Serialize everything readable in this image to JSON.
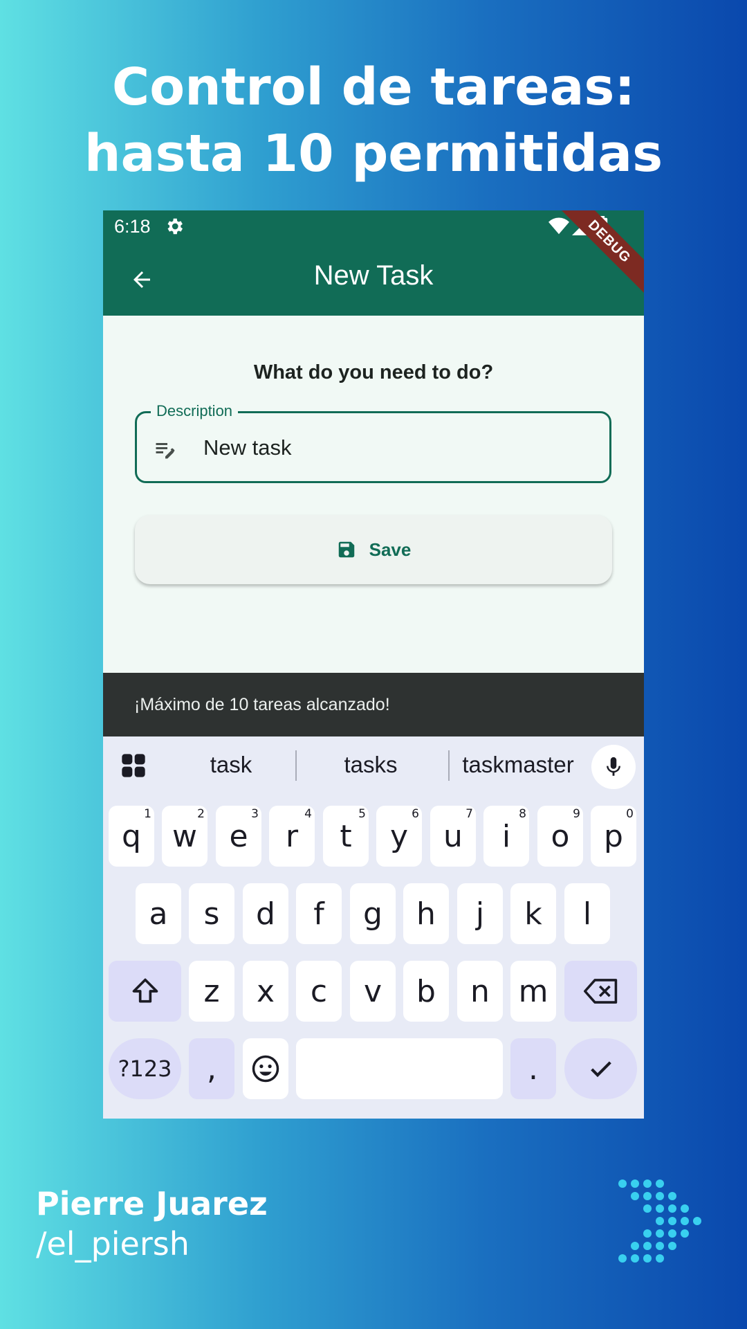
{
  "headline": {
    "line1": "Control de tareas:",
    "line2": "hasta 10 permitidas"
  },
  "status_bar": {
    "time": "6:18",
    "icons": [
      "gear-icon",
      "wifi-icon",
      "signal-icon",
      "battery-icon"
    ]
  },
  "debug_banner": "DEBUG",
  "app_bar": {
    "title": "New Task",
    "back_icon": "arrow-back-icon"
  },
  "form": {
    "question": "What do you need to do?",
    "description_label": "Description",
    "description_value": "New task",
    "description_icon": "edit-note-icon",
    "save_label": "Save",
    "save_icon": "save-icon"
  },
  "snackbar": {
    "message": "¡Máximo de 10 tareas alcanzado!"
  },
  "keyboard": {
    "suggestions": [
      "task",
      "tasks",
      "taskmaster"
    ],
    "row1": [
      {
        "key": "q",
        "hint": "1"
      },
      {
        "key": "w",
        "hint": "2"
      },
      {
        "key": "e",
        "hint": "3"
      },
      {
        "key": "r",
        "hint": "4"
      },
      {
        "key": "t",
        "hint": "5"
      },
      {
        "key": "y",
        "hint": "6"
      },
      {
        "key": "u",
        "hint": "7"
      },
      {
        "key": "i",
        "hint": "8"
      },
      {
        "key": "o",
        "hint": "9"
      },
      {
        "key": "p",
        "hint": "0"
      }
    ],
    "row2": [
      "a",
      "s",
      "d",
      "f",
      "g",
      "h",
      "j",
      "k",
      "l"
    ],
    "row3": [
      "z",
      "x",
      "c",
      "v",
      "b",
      "n",
      "m"
    ],
    "symbols_label": "?123",
    "comma_label": ",",
    "period_label": "."
  },
  "branding": {
    "name": "Pierre Juarez",
    "handle": "/el_piersh"
  },
  "colors": {
    "app_primary": "#116c56",
    "app_background": "#f1f9f5",
    "snackbar_bg": "#2e3231",
    "keyboard_bg": "#e8ebf6",
    "keyboard_mod_key": "#dcdcf8"
  }
}
